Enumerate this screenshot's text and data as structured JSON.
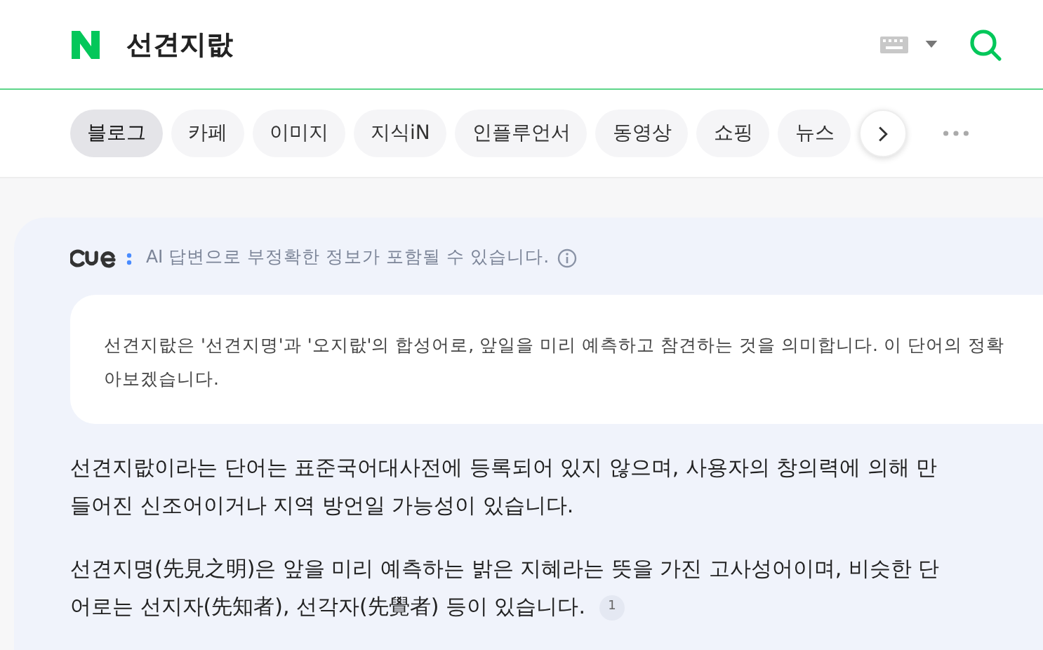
{
  "header": {
    "query": "선견지랎"
  },
  "tabs": [
    {
      "label": "블로그",
      "selected": true
    },
    {
      "label": "카페",
      "selected": false
    },
    {
      "label": "이미지",
      "selected": false
    },
    {
      "label": "지식iN",
      "selected": false
    },
    {
      "label": "인플루언서",
      "selected": false
    },
    {
      "label": "동영상",
      "selected": false
    },
    {
      "label": "쇼핑",
      "selected": false
    },
    {
      "label": "뉴스",
      "selected": false
    }
  ],
  "answer": {
    "notice": "AI 답변으로 부정확한 정보가 포함될 수 있습니다.",
    "summary_lines": [
      "선견지랎은 '선견지명'과 '오지랎'의 합성어로, 앞일을 미리 예측하고 참견하는 것을 의미합니다. 이 단어의 정확",
      "아보겠습니다."
    ],
    "paragraphs": [
      {
        "lines": [
          "선견지랎이라는 단어는 표준국어대사전에 등록되어 있지 않으며, 사용자의 창의력에 의해 만",
          "들어진 신조어이거나 지역 방언일 가능성이 있습니다."
        ]
      },
      {
        "lines": [
          "선견지명(先見之明)은 앞을 미리 예측하는 밝은 지혜라는 뜻을 가진 고사성어이며, 비슷한 단",
          "어로는 선지자(先知者), 선각자(先覺者) 등이 있습니다."
        ],
        "citation": "1"
      }
    ]
  }
}
